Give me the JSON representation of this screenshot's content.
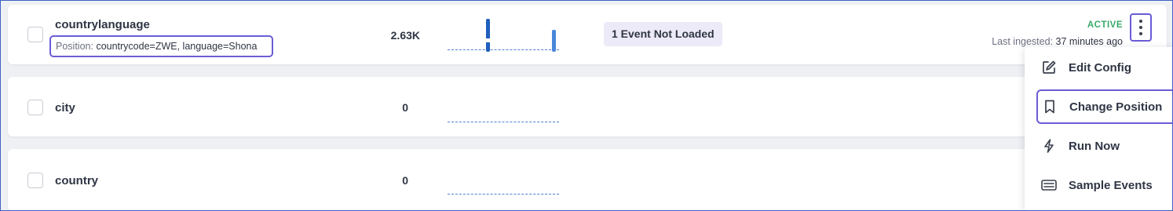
{
  "rows": [
    {
      "name": "countrylanguage",
      "position_label": "Position:",
      "position_value": "countrycode=ZWE, language=Shona",
      "count": "2.63K",
      "badge": "1 Event Not Loaded",
      "status": "ACTIVE",
      "ingest_label": "Last ingested:",
      "ingest_value": "37 minutes ago"
    },
    {
      "name": "city",
      "count": "0"
    },
    {
      "name": "country",
      "count": "0"
    }
  ],
  "menu": {
    "items": [
      {
        "label": "Edit Config",
        "icon": "edit-icon"
      },
      {
        "label": "Change Position",
        "icon": "bookmark-icon"
      },
      {
        "label": "Run Now",
        "icon": "lightning-icon"
      },
      {
        "label": "Sample Events",
        "icon": "list-icon"
      }
    ]
  },
  "colors": {
    "accent": "#6a5cd6",
    "active": "#39a96b",
    "chart": "#1f5fbd"
  }
}
